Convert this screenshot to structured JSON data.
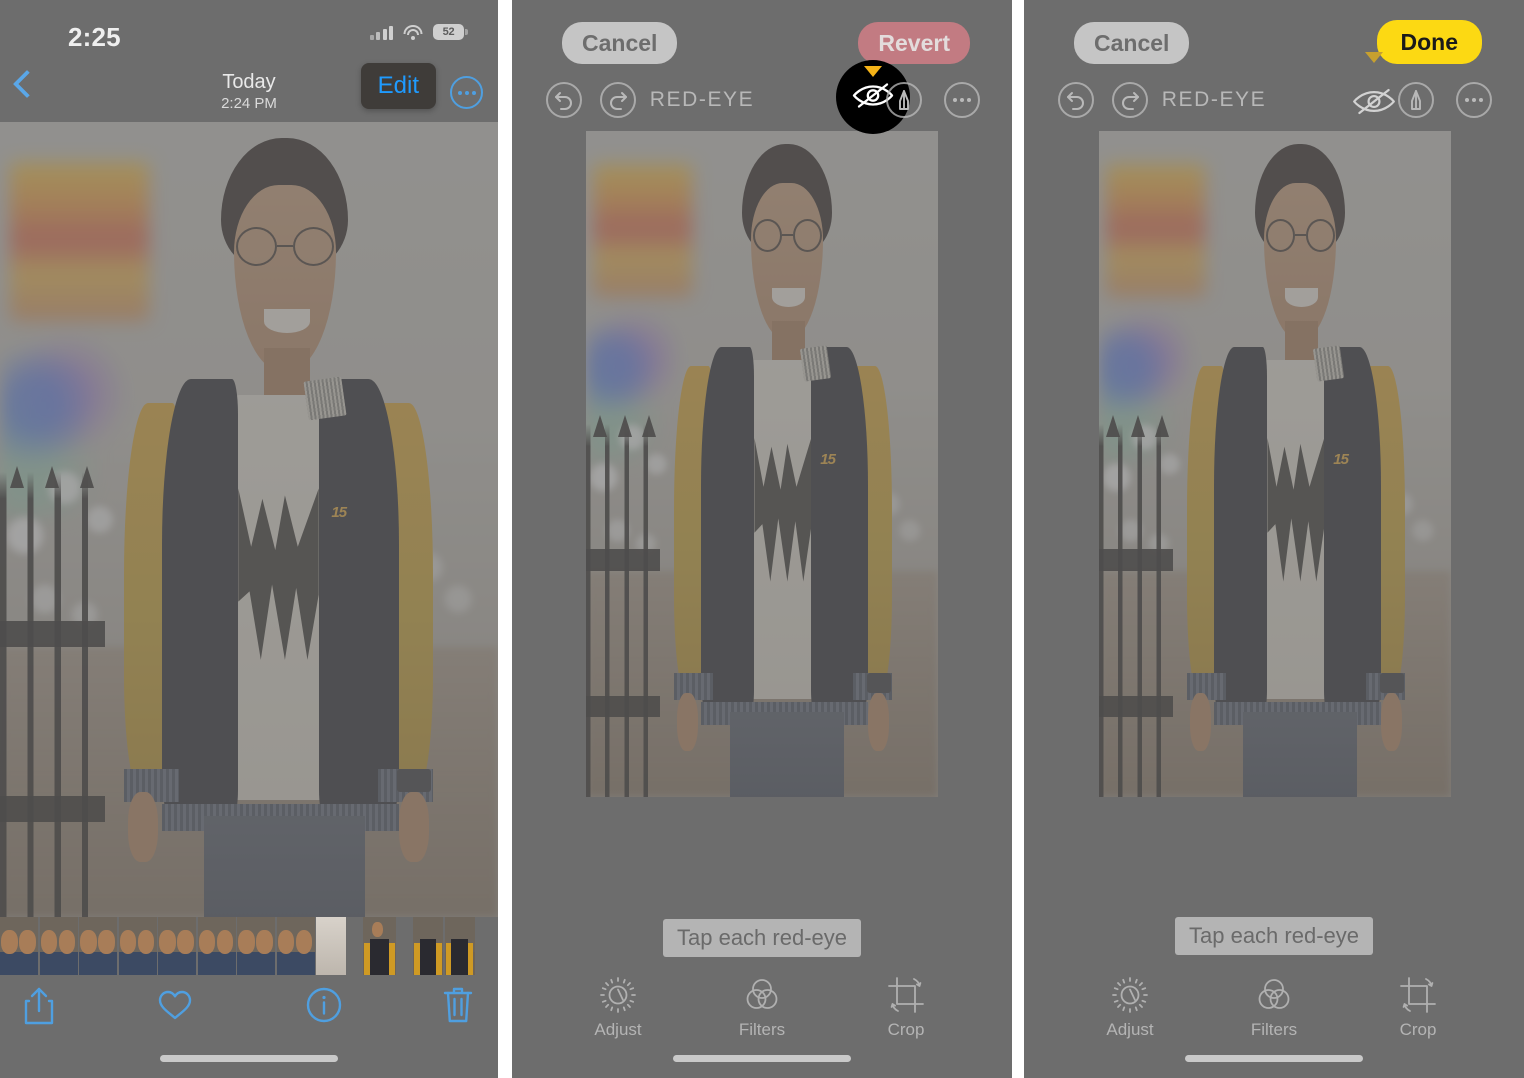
{
  "screenshot": {
    "title": "iPhone Photos app — remove red-eye walkthrough (3 steps)",
    "panel_count": 3
  },
  "colors": {
    "ios_blue": "#4f9fe0",
    "edit_blue": "#1f9bff",
    "done_yellow": "#fcd913",
    "revert_red": "#c27b82",
    "cancel_grey": "#c5c5c5",
    "marker_yellow": "#f5b318",
    "dim_overlay": "rgba(112,112,112,0.62)"
  },
  "panel1": {
    "name": "photo-viewer",
    "statusbar": {
      "time": "2:25",
      "signal_icon": "cellular-signal-icon",
      "wifi_icon": "wifi-icon",
      "battery_icon": "battery-icon",
      "battery_level": "52"
    },
    "navbar": {
      "back_icon": "chevron-left-icon",
      "title": "Today",
      "subtitle": "2:24 PM",
      "edit_label": "Edit",
      "more_icon": "ellipsis-circle-icon"
    },
    "bottombar": {
      "share_icon": "share-icon",
      "favorite_icon": "heart-icon",
      "info_icon": "info-circle-icon",
      "delete_icon": "trash-icon"
    }
  },
  "panel2": {
    "name": "red-eye-editor-active",
    "topbar": {
      "cancel_label": "Cancel",
      "revert_label": "Revert",
      "undo_icon": "undo-arrow-icon",
      "redo_icon": "redo-arrow-icon",
      "mode_label": "RED-EYE",
      "redeye_icon": "eye-slash-icon",
      "redeye_selected": true,
      "markup_icon": "markup-pen-icon",
      "more_icon": "ellipsis-circle-icon"
    },
    "hint": "Tap each red-eye",
    "tools": [
      {
        "icon": "adjust-icon",
        "label": "Adjust"
      },
      {
        "icon": "filters-icon",
        "label": "Filters"
      },
      {
        "icon": "crop-icon",
        "label": "Crop"
      }
    ]
  },
  "panel3": {
    "name": "red-eye-editor-done",
    "topbar": {
      "cancel_label": "Cancel",
      "done_label": "Done",
      "undo_icon": "undo-arrow-icon",
      "redo_icon": "redo-arrow-icon",
      "mode_label": "RED-EYE",
      "redeye_icon": "eye-slash-icon",
      "redeye_selected": false,
      "markup_icon": "markup-pen-icon",
      "more_icon": "ellipsis-circle-icon"
    },
    "hint": "Tap each red-eye",
    "tools": [
      {
        "icon": "adjust-icon",
        "label": "Adjust"
      },
      {
        "icon": "filters-icon",
        "label": "Filters"
      },
      {
        "icon": "crop-icon",
        "label": "Crop"
      }
    ]
  },
  "photo": {
    "description": "Young man with glasses in a yellow and black varsity jacket, smiling, standing in front of an iron fence at night with blurred neon lights",
    "jacket_number": "15"
  }
}
